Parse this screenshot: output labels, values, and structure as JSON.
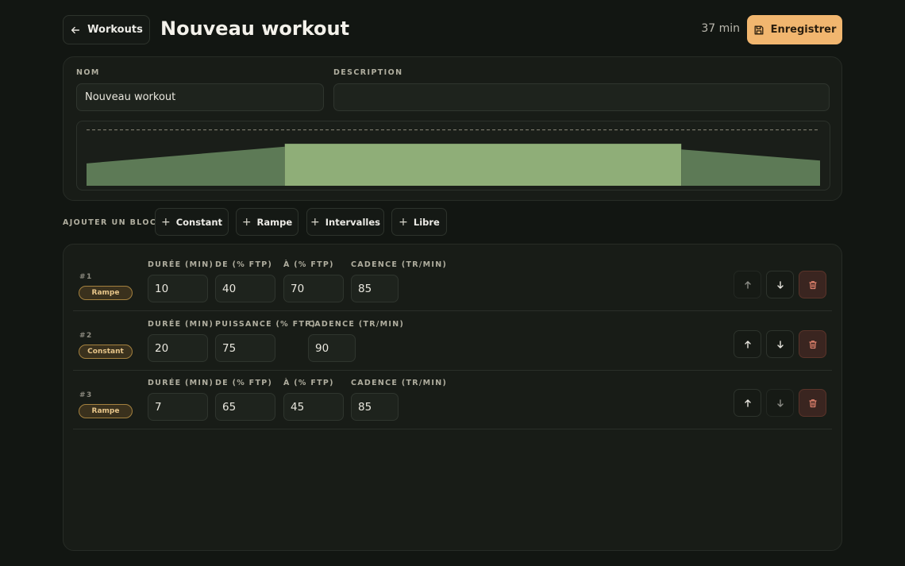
{
  "header": {
    "back_label": "Workouts",
    "title": "Nouveau workout",
    "total_duration": "37 min",
    "save_label": "Enregistrer"
  },
  "form": {
    "name_label": "NOM",
    "name_value": "Nouveau workout",
    "description_label": "DESCRIPTION",
    "description_value": ""
  },
  "add_block": {
    "label": "AJOUTER UN BLOC :",
    "buttons": [
      "Constant",
      "Rampe",
      "Intervalles",
      "Libre"
    ]
  },
  "blocks": [
    {
      "number": "#1",
      "type": "Rampe",
      "fields": [
        {
          "label": "DURÉE (MIN)",
          "value": "10"
        },
        {
          "label": "DE (% FTP)",
          "value": "40"
        },
        {
          "label": "À (% FTP)",
          "value": "70"
        },
        {
          "label": "CADENCE (TR/MIN)",
          "value": "85"
        }
      ]
    },
    {
      "number": "#2",
      "type": "Constant",
      "fields": [
        {
          "label": "DURÉE (MIN)",
          "value": "20"
        },
        {
          "label": "PUISSANCE (% FTP)",
          "value": "75"
        },
        {
          "label": "CADENCE (TR/MIN)",
          "value": "90"
        }
      ]
    },
    {
      "number": "#3",
      "type": "Rampe",
      "fields": [
        {
          "label": "DURÉE (MIN)",
          "value": "7"
        },
        {
          "label": "DE (% FTP)",
          "value": "65"
        },
        {
          "label": "À (% FTP)",
          "value": "45"
        },
        {
          "label": "CADENCE (TR/MIN)",
          "value": "85"
        }
      ]
    }
  ],
  "chart_data": {
    "type": "area",
    "x_unit": "min",
    "y_unit": "% FTP",
    "segments": [
      {
        "start": 0,
        "end": 10,
        "from": 40,
        "to": 70
      },
      {
        "start": 10,
        "end": 30,
        "from": 75,
        "to": 75
      },
      {
        "start": 30,
        "end": 37,
        "from": 65,
        "to": 45
      }
    ],
    "reference_line": 100,
    "ylim": [
      0,
      115
    ],
    "highlighted_segment": 1
  },
  "colors": {
    "accent": "#f1b66f",
    "ramp_fill": "#5d7a56",
    "constant_fill": "#8fae78",
    "danger_bg": "#3a2520",
    "danger_icon": "#e0826d"
  },
  "icons": {
    "back": "arrow-left-icon",
    "save": "save-icon",
    "add": "plus-icon",
    "up": "arrow-up-icon",
    "down": "arrow-down-icon",
    "delete": "trash-icon"
  }
}
